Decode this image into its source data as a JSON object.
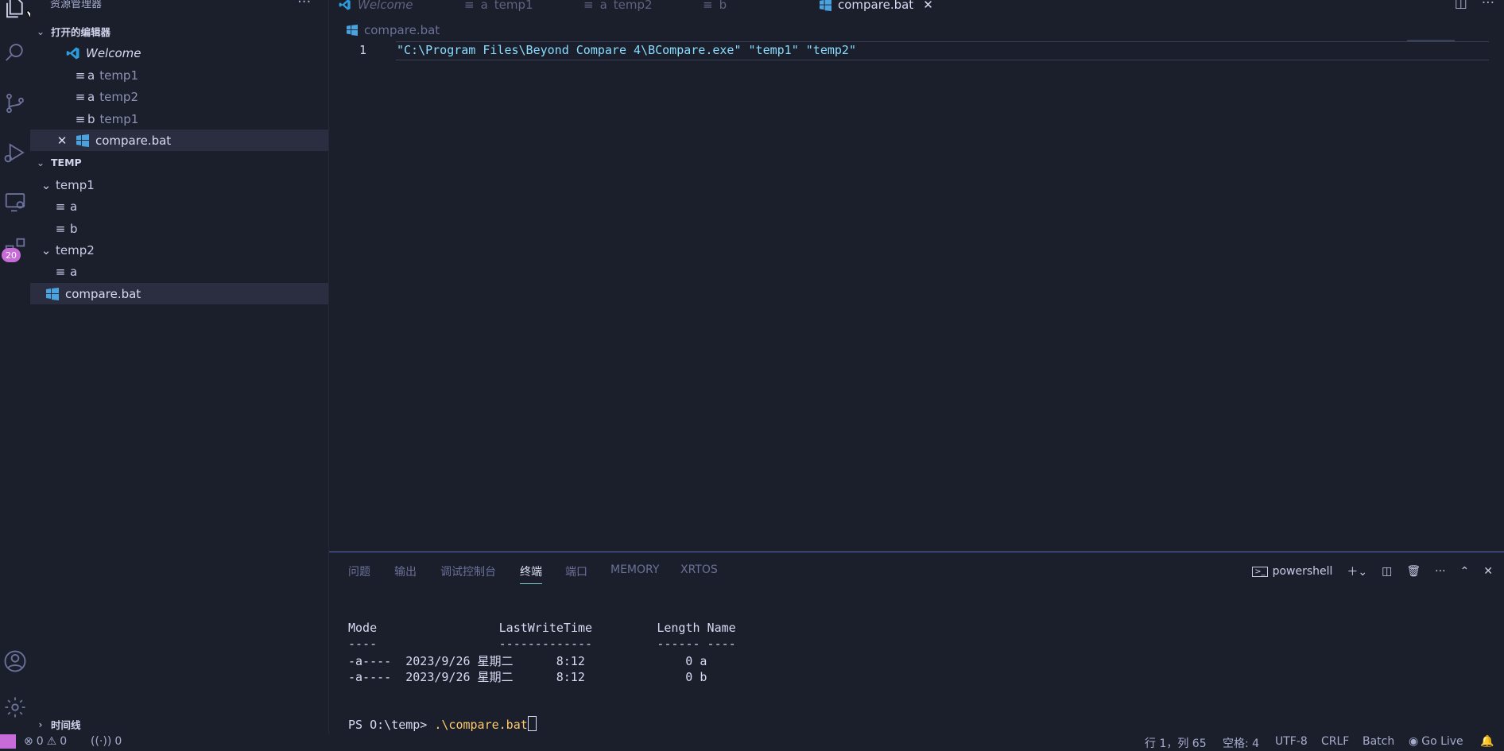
{
  "sidebar": {
    "title": "资源管理器",
    "more": "···",
    "open_editors_header": "打开的编辑器",
    "open_editors": [
      {
        "prefix": "",
        "name": "Welcome",
        "icon": "vscode-icon"
      },
      {
        "prefix": "a",
        "name": "temp1",
        "icon": "file-lines-icon"
      },
      {
        "prefix": "a",
        "name": "temp2",
        "icon": "file-lines-icon"
      },
      {
        "prefix": "b",
        "name": "temp1",
        "icon": "file-lines-icon"
      },
      {
        "prefix": "",
        "name": "compare.bat",
        "icon": "windows-icon"
      }
    ],
    "workspace_header": "TEMP",
    "tree": {
      "temp1": "temp1",
      "temp1_a": "a",
      "temp1_b": "b",
      "temp2": "temp2",
      "temp2_a": "a",
      "compare": "compare.bat"
    },
    "badge": "20",
    "timeline_header": "时间线"
  },
  "tabs": [
    {
      "prefix": "",
      "label": "Welcome",
      "icon": "vscode-icon"
    },
    {
      "prefix": "a",
      "label": "temp1",
      "icon": "file-lines-icon"
    },
    {
      "prefix": "a",
      "label": "temp2",
      "icon": "file-lines-icon"
    },
    {
      "prefix": "",
      "label": "b",
      "icon": "file-lines-icon"
    },
    {
      "prefix": "",
      "label": "compare.bat",
      "icon": "windows-icon",
      "active": true
    }
  ],
  "editor": {
    "breadcrumb": "compare.bat",
    "line_number": "1",
    "code": "\"C:\\Program Files\\Beyond Compare 4\\BCompare.exe\" \"temp1\" \"temp2\""
  },
  "panel": {
    "tabs": [
      "问题",
      "输出",
      "调试控制台",
      "终端",
      "端口",
      "MEMORY",
      "XRTOS"
    ],
    "active_tab": "终端",
    "shell": "powershell",
    "terminal_lines": [
      "Mode                 LastWriteTime         Length Name",
      "----                 -------------         ------ ----",
      "-a----  2023/9/26 星期二      8:12              0 a",
      "-a----  2023/9/26 星期二      8:12              0 b"
    ],
    "prompt": "PS O:\\temp> ",
    "command": ".\\compare.bat"
  },
  "status": {
    "errors": "0",
    "warnings": "0",
    "ports": "0",
    "position": "行 1，列 65",
    "spaces": "空格: 4",
    "encoding": "UTF-8",
    "eol": "CRLF",
    "language": "Batch",
    "golive": "Go Live"
  },
  "colors": {
    "background": "#1b1e2b",
    "accent": "#c76bd9",
    "code": "#89ddff",
    "panel_border": "#5c6bb5"
  }
}
